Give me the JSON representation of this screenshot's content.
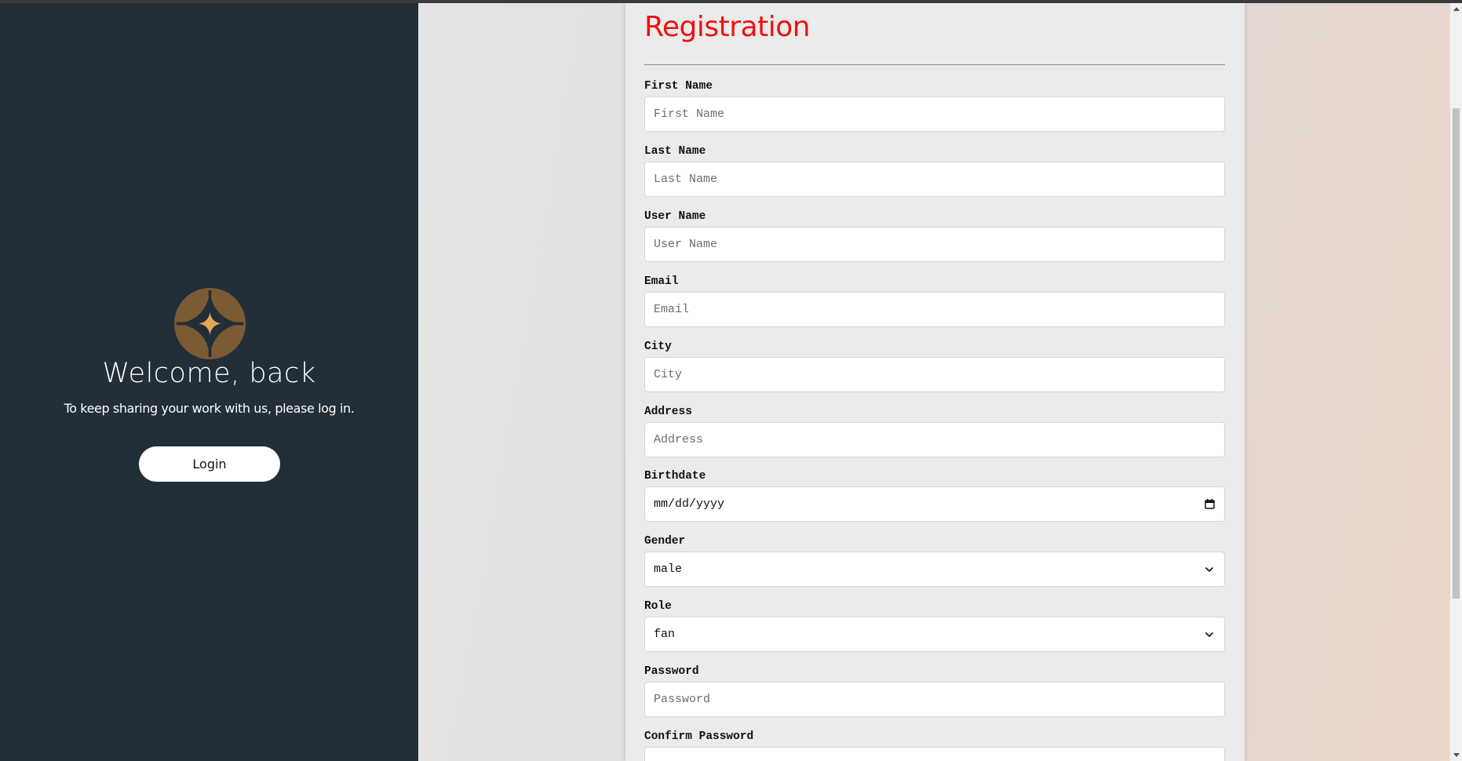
{
  "left_panel": {
    "logo_icon": "star-compass-icon",
    "welcome": "Welcome, back",
    "subtitle": "To keep sharing your work with us, please log in.",
    "login_button": "Login",
    "bg_color": "#222e38",
    "logo_color": "#7c5a34",
    "logo_star_color": "#e8a654"
  },
  "form": {
    "title": "Registration",
    "title_color": "#ee1111",
    "fields": [
      {
        "label": "First Name",
        "placeholder": "First Name",
        "type": "text"
      },
      {
        "label": "Last Name",
        "placeholder": "Last Name",
        "type": "text"
      },
      {
        "label": "User Name",
        "placeholder": "User Name",
        "type": "text"
      },
      {
        "label": "Email",
        "placeholder": "Email",
        "type": "email"
      },
      {
        "label": "City",
        "placeholder": "City",
        "type": "text"
      },
      {
        "label": "Address",
        "placeholder": "Address",
        "type": "text"
      },
      {
        "label": "Birthdate",
        "placeholder": "mm/dd/yyyy",
        "type": "date"
      },
      {
        "label": "Gender",
        "value": "male",
        "type": "select"
      },
      {
        "label": "Role",
        "value": "fan",
        "type": "select"
      },
      {
        "label": "Password",
        "placeholder": "Password",
        "type": "password"
      },
      {
        "label": "Confirm Password",
        "placeholder": "",
        "type": "password"
      }
    ]
  }
}
